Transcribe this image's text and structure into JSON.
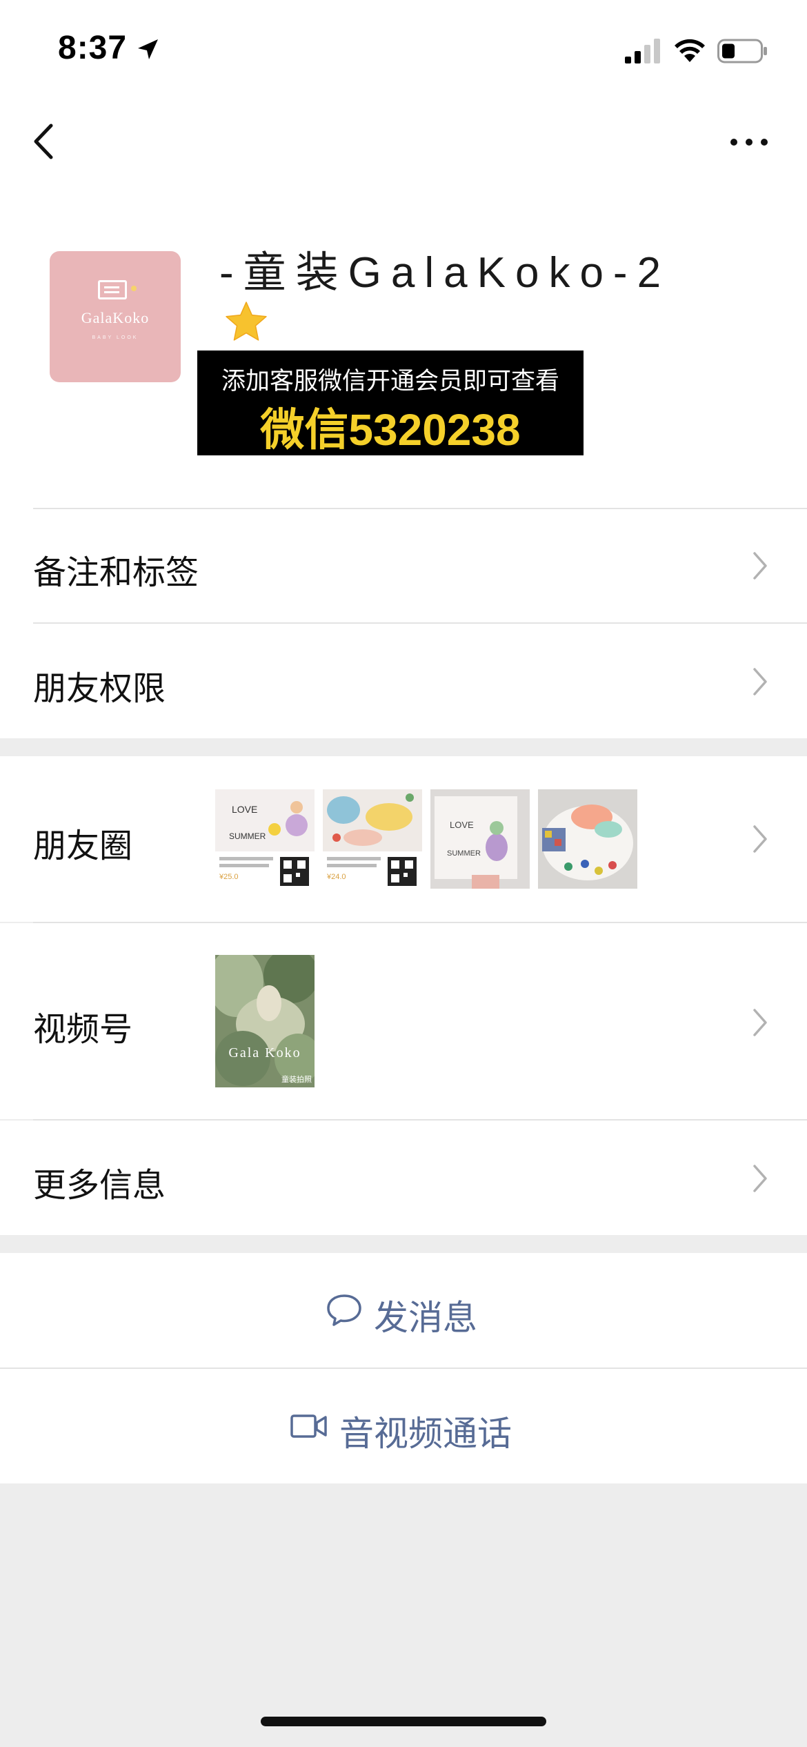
{
  "status_bar": {
    "time": "8:37"
  },
  "nav": {
    "back_icon": "chevron-left-icon",
    "more_icon": "ellipsis-icon"
  },
  "profile": {
    "name": "-童装GalaKoko-2",
    "avatar_text": "GalaKoko",
    "avatar_subtext": "BABY LOOK",
    "star_icon": "star-icon",
    "star_color": "#f7c22e"
  },
  "promo_overlay": {
    "line1": "添加客服微信开通会员即可查看",
    "line2": "微信5320238",
    "line2_color": "#f5d02a"
  },
  "rows": {
    "remarks_tags": "备注和标签",
    "friend_permissions": "朋友权限",
    "moments": "朋友圈",
    "channels": "视频号",
    "more_info": "更多信息"
  },
  "moments_thumbs": [
    {
      "caption": "LOVE SUMMER",
      "price": "¥25.0"
    },
    {
      "caption": "",
      "price": "¥24.0"
    },
    {
      "caption": "LOVE SUMMER",
      "price": ""
    },
    {
      "caption": "",
      "price": ""
    }
  ],
  "channels_thumb": {
    "title": "Gala Koko",
    "subtitle": "童装拍照"
  },
  "actions": {
    "send_message": "发消息",
    "av_call": "音视频通话"
  },
  "colors": {
    "link_blue": "#576b95",
    "background_gray": "#ededed"
  }
}
